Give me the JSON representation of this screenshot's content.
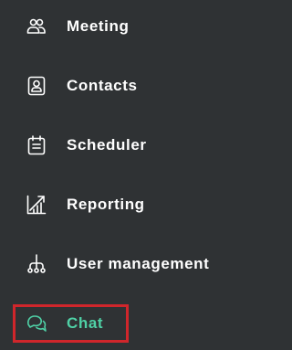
{
  "colors": {
    "background": "#2f3234",
    "text": "#ffffff",
    "active_text": "#4fd1a6",
    "highlight_border": "#d0262b"
  },
  "nav": {
    "items": [
      {
        "label": "Meeting",
        "icon": "people-icon",
        "active": false
      },
      {
        "label": "Contacts",
        "icon": "contact-card-icon",
        "active": false
      },
      {
        "label": "Scheduler",
        "icon": "calendar-icon",
        "active": false
      },
      {
        "label": "Reporting",
        "icon": "chart-trend-icon",
        "active": false
      },
      {
        "label": "User management",
        "icon": "org-chart-icon",
        "active": false
      },
      {
        "label": "Chat",
        "icon": "chat-bubbles-icon",
        "active": true
      }
    ]
  }
}
